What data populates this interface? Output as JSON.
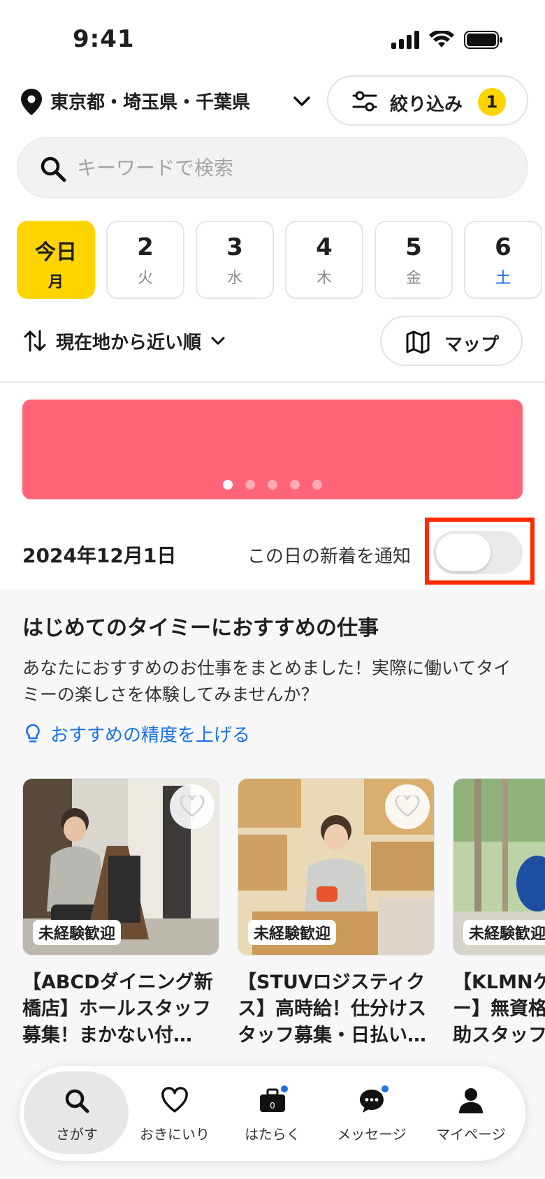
{
  "status": {
    "time": "9:41"
  },
  "location": {
    "label": "東京都・埼玉県・千葉県"
  },
  "filter": {
    "label": "絞り込み",
    "count": "1"
  },
  "search": {
    "placeholder": "キーワードで検索"
  },
  "dates": [
    {
      "num": "今日",
      "day": "月",
      "selected": true
    },
    {
      "num": "2",
      "day": "火"
    },
    {
      "num": "3",
      "day": "水"
    },
    {
      "num": "4",
      "day": "木"
    },
    {
      "num": "5",
      "day": "金"
    },
    {
      "num": "6",
      "day": "土",
      "weekend": "saturday"
    }
  ],
  "sort": {
    "label": "現在地から近い順"
  },
  "map": {
    "label": "マップ"
  },
  "banner": {
    "page_count": 5,
    "active_index": 0,
    "color": "#ff6479"
  },
  "notify": {
    "date": "2024年12月1日",
    "label": "この日の新着を通知",
    "enabled": false
  },
  "recommend": {
    "title": "はじめてのタイミーにおすすめの仕事",
    "description": "あなたにおすすめのお仕事をまとめました！実際に働いてタイミーの楽しさを体験してみませんか？",
    "link": "おすすめの精度を上げる",
    "cards": [
      {
        "tag": "未経験歓迎",
        "title": "【ABCDダイニング新橋店】ホールスタッフ募集！まかない付…",
        "image": "restaurant-staff-photo"
      },
      {
        "tag": "未経験歓迎",
        "title": "【STUVロジスティクス】高時給！仕分けスタッフ募集・日払い…",
        "image": "warehouse-staff-photo"
      },
      {
        "tag": "未経験歓迎",
        "title": "【KLMNケアセンター】無資格OK介護補助スタッフ",
        "image": "outdoor-staff-photo"
      }
    ]
  },
  "tabs": [
    {
      "label": "さがす",
      "icon": "search-icon",
      "active": true
    },
    {
      "label": "おきにいり",
      "icon": "heart-icon"
    },
    {
      "label": "はたらく",
      "icon": "briefcase-icon",
      "badge": true
    },
    {
      "label": "メッセージ",
      "icon": "chat-icon",
      "badge": true
    },
    {
      "label": "マイページ",
      "icon": "person-icon"
    }
  ],
  "colors": {
    "accent": "#ffd400",
    "link": "#1a73e8",
    "highlight": "#ff2a00"
  }
}
